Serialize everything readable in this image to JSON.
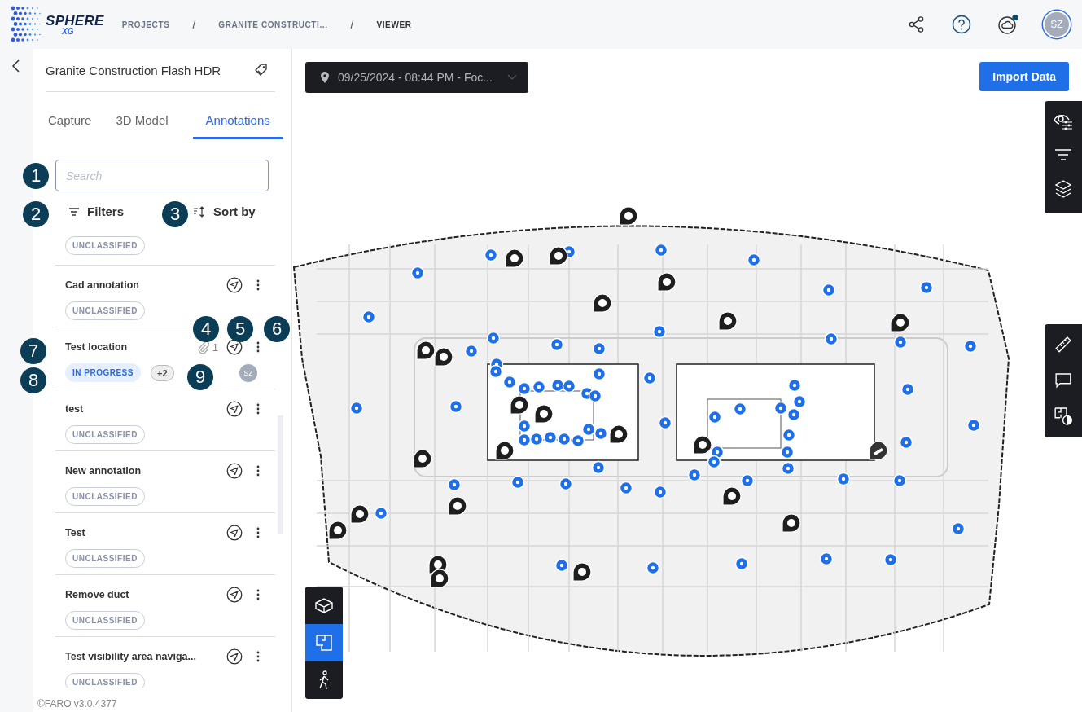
{
  "header": {
    "logo": {
      "name": "SPHERE",
      "sub": "XG"
    },
    "breadcrumbs": [
      {
        "label": "PROJECTS",
        "current": false
      },
      {
        "label": "GRANITE CONSTRUCTI...",
        "current": false
      },
      {
        "label": "VIEWER",
        "current": true
      }
    ],
    "separator": "/",
    "notification": true,
    "avatar": "SZ"
  },
  "sidebar": {
    "title": "Granite Construction Flash HDR",
    "tabs": [
      {
        "label": "Capture",
        "selected": false
      },
      {
        "label": "3D Model",
        "selected": false
      },
      {
        "label": "Annotations",
        "selected": true
      }
    ],
    "search": {
      "placeholder": "Search"
    },
    "filters": "Filters",
    "sort": "Sort by",
    "annotations": [
      {
        "tag": {
          "label": "UNCLASSIFIED",
          "kind": "unclassified"
        }
      },
      {
        "title": "Cad annotation",
        "tag": {
          "label": "UNCLASSIFIED",
          "kind": "unclassified"
        }
      },
      {
        "title": "Test location",
        "attachments": "1",
        "tag": {
          "label": "IN PROGRESS",
          "kind": "in_progress"
        },
        "extra_tags": "+2",
        "assignee": "SZ"
      },
      {
        "title": "test",
        "tag": {
          "label": "UNCLASSIFIED",
          "kind": "unclassified"
        }
      },
      {
        "title": "New annotation",
        "tag": {
          "label": "UNCLASSIFIED",
          "kind": "unclassified"
        }
      },
      {
        "title": "Test",
        "tag": {
          "label": "UNCLASSIFIED",
          "kind": "unclassified"
        }
      },
      {
        "title": "Remove duct",
        "tag": {
          "label": "UNCLASSIFIED",
          "kind": "unclassified"
        }
      },
      {
        "title": "Test visibility area naviga...",
        "tag": {
          "label": "UNCLASSIFIED",
          "kind": "unclassified"
        }
      }
    ],
    "version": "©FARO v3.0.4377"
  },
  "viewer": {
    "capture": "09/25/2024 - 08:44 PM - Foc...",
    "import_button": "Import Data",
    "view_modes": [
      {
        "kind": "cube",
        "selected": false
      },
      {
        "kind": "floorplan",
        "selected": true
      },
      {
        "kind": "walk",
        "selected": false
      }
    ]
  },
  "callouts": [
    "1",
    "2",
    "3",
    "4",
    "5",
    "6",
    "7",
    "8",
    "9"
  ]
}
